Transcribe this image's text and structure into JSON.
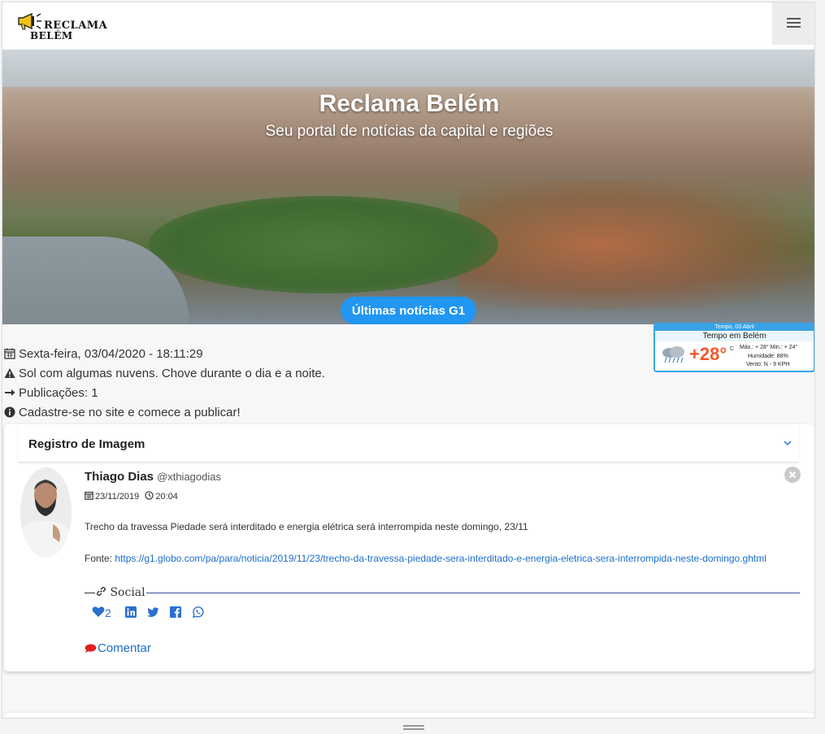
{
  "brand": {
    "line1": "RECLAMA",
    "line2": "BELÉM"
  },
  "hero": {
    "title": "Reclama Belém",
    "subtitle": "Seu portal de notícias da capital e regiões",
    "button_label": "Últimas notícias G1"
  },
  "weather": {
    "date": "Tempo, 03 Abril",
    "title": "Tempo em Belém",
    "temperature": "+28°",
    "unit": "C",
    "max_min": "Máx.: + 28° Min.: + 24°",
    "humidity": "Humidade: 88%",
    "wind": "Vento: N - 9 KPH"
  },
  "info": {
    "datetime": "Sexta-feira, 03/04/2020 - 18:11:29",
    "forecast": "Sol com algumas nuvens. Chove durante o dia e a noite.",
    "publications": "Publicações: 1",
    "signup": "Cadastre-se no site e comece a publicar!"
  },
  "card": {
    "title": "Registro de Imagem",
    "post": {
      "author": "Thiago Dias",
      "handle": "@xthiagodias",
      "date": "23/11/2019",
      "time": "20:04",
      "text": "Trecho da travessa Piedade será interditado e energia elétrica será interrompida neste domingo, 23/11",
      "source_label": "Fonte: ",
      "source_url": "https://g1.globo.com/pa/para/noticia/2019/11/23/trecho-da-travessa-piedade-sera-interditado-e-energia-eletrica-sera-interrompida-neste-domingo.ghtml",
      "social_label": "Social",
      "likes": "2",
      "comment_label": "Comentar"
    }
  },
  "colors": {
    "accent": "#2196f3",
    "link": "#1a6dc8",
    "temp": "#f0582d",
    "comment_icon": "#e02020"
  },
  "icons": [
    "megaphone-icon",
    "hamburger-icon",
    "calendar-icon",
    "warning-icon",
    "arrow-right-icon",
    "info-icon",
    "chevron-down-icon",
    "clock-icon",
    "close-icon",
    "link-icon",
    "heart-icon",
    "linkedin-icon",
    "twitter-icon",
    "facebook-icon",
    "whatsapp-icon",
    "comment-icon",
    "cloud-rain-icon"
  ]
}
